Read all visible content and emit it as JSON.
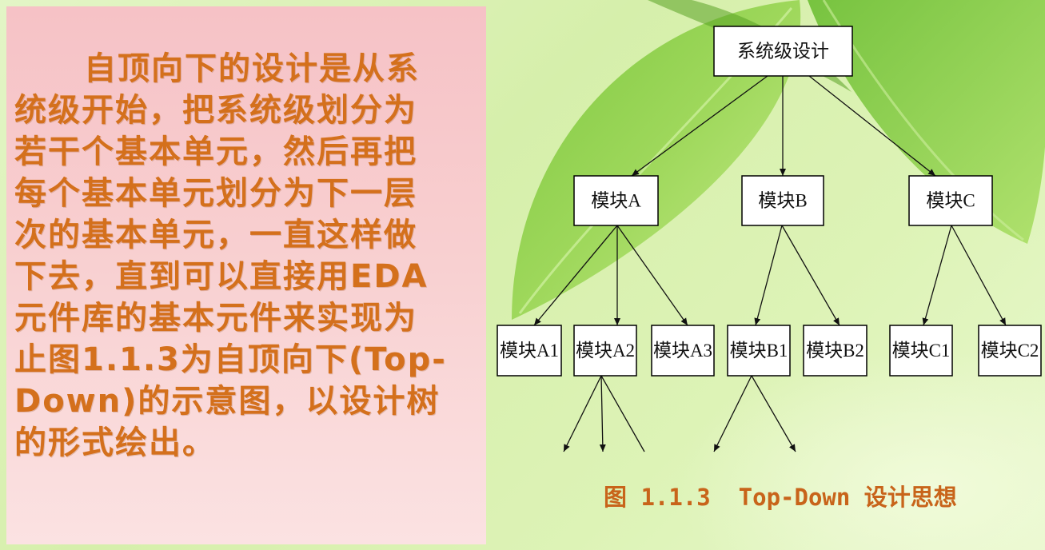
{
  "text_panel": {
    "lines": [
      "自顶向下的设计是从系",
      "统级开始，把系统级划分为",
      "若干个基本单元，然后再把",
      "每个基本单元划分为下一层",
      "次的基本单元，一直这样做",
      "下去，直到可以直接用EDA",
      "元件库的基本元件来实现为",
      "止图1.1.3为自顶向下(Top-",
      "Down)的示意图，以设计树",
      "的形式绘出。"
    ]
  },
  "diagram": {
    "tree": {
      "label": "系统级设计",
      "children": [
        {
          "label": "模块A",
          "children": [
            {
              "label": "模块A1"
            },
            {
              "label": "模块A2"
            },
            {
              "label": "模块A3"
            }
          ]
        },
        {
          "label": "模块B",
          "children": [
            {
              "label": "模块B1"
            },
            {
              "label": "模块B2"
            }
          ]
        },
        {
          "label": "模块C",
          "children": [
            {
              "label": "模块C1"
            },
            {
              "label": "模块C2"
            }
          ]
        }
      ]
    },
    "caption": "图 1.1.3  Top-Down 设计思想"
  },
  "colors": {
    "text": "#d4701c",
    "caption": "#c8641a",
    "panel": "#f6c2c6",
    "node_border": "#000000",
    "node_fill": "#ffffff"
  }
}
